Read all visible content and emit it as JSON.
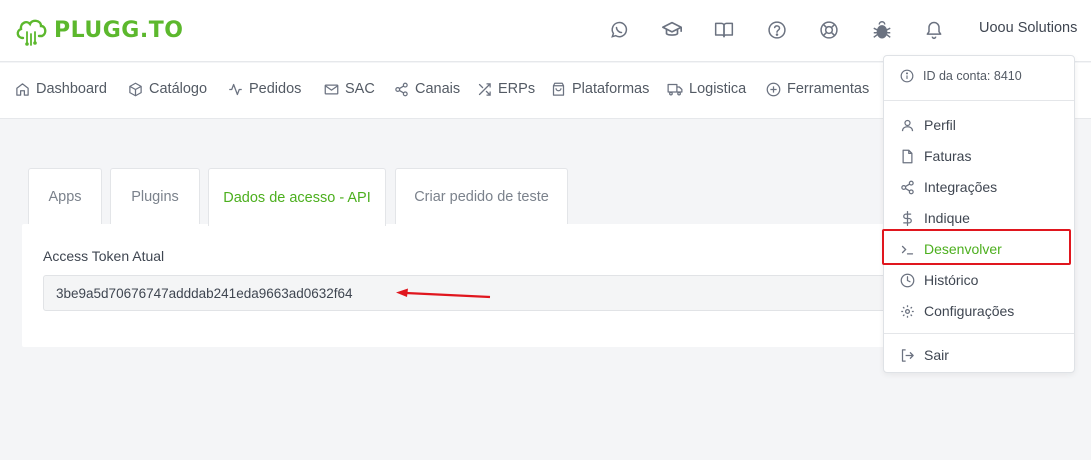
{
  "brand": {
    "name": "PLUGG.TO",
    "color": "#5cb82d"
  },
  "header": {
    "icons": [
      "whatsapp-icon",
      "graduation-cap-icon",
      "book-open-icon",
      "help-circle-icon",
      "life-buoy-icon",
      "bug-icon",
      "bell-icon"
    ],
    "user_name": "Uoou Solutions"
  },
  "nav": {
    "items": [
      {
        "label": "Dashboard",
        "icon": "home-icon"
      },
      {
        "label": "Catálogo",
        "icon": "box-icon"
      },
      {
        "label": "Pedidos",
        "icon": "activity-icon"
      },
      {
        "label": "SAC",
        "icon": "mail-icon"
      },
      {
        "label": "Canais",
        "icon": "share-icon"
      },
      {
        "label": "ERPs",
        "icon": "shuffle-icon"
      },
      {
        "label": "Plataformas",
        "icon": "shopping-bag-icon"
      },
      {
        "label": "Logistica",
        "icon": "truck-icon"
      },
      {
        "label": "Ferramentas",
        "icon": "plus-circle-icon"
      }
    ]
  },
  "tabs": [
    {
      "label": "Apps",
      "active": false
    },
    {
      "label": "Plugins",
      "active": false
    },
    {
      "label": "Dados de acesso - API",
      "active": true
    },
    {
      "label": "Criar pedido de teste",
      "active": false
    }
  ],
  "token": {
    "label": "Access Token Atual",
    "value": "3be9a5d70676747adddab241eda9663ad0632f64"
  },
  "dropdown": {
    "account": "ID da conta: 8410",
    "items": [
      {
        "label": "Perfil",
        "icon": "user-icon"
      },
      {
        "label": "Faturas",
        "icon": "file-icon"
      },
      {
        "label": "Integrações",
        "icon": "share-icon"
      },
      {
        "label": "Indique",
        "icon": "dollar-icon"
      },
      {
        "label": "Desenvolver",
        "icon": "terminal-icon",
        "highlighted": true
      },
      {
        "label": "Histórico",
        "icon": "clock-icon"
      },
      {
        "label": "Configurações",
        "icon": "settings-icon"
      }
    ],
    "logout": {
      "label": "Sair",
      "icon": "log-out-icon"
    }
  },
  "colors": {
    "accent": "#4caf1e",
    "highlight_border": "#e0161e",
    "arrow": "#e0161e"
  }
}
